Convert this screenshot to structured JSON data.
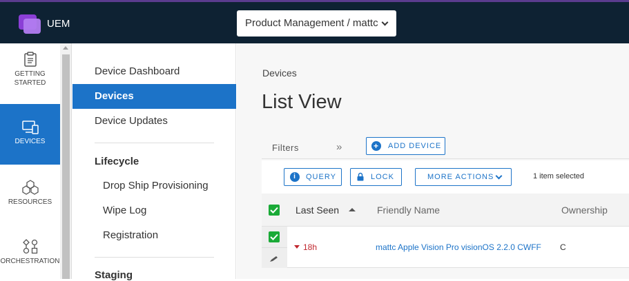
{
  "header": {
    "app_name": "UEM",
    "org_selector": "Product Management / mattc"
  },
  "leftnav": {
    "items": [
      {
        "label_line1": "GETTING",
        "label_line2": "STARTED",
        "icon": "clipboard-icon"
      },
      {
        "label_line1": "DEVICES",
        "label_line2": "",
        "icon": "devices-icon"
      },
      {
        "label_line1": "RESOURCES",
        "label_line2": "",
        "icon": "cubes-icon"
      },
      {
        "label_line1": "ORCHESTRATION",
        "label_line2": "",
        "icon": "workflow-icon"
      }
    ]
  },
  "subnav": {
    "items": [
      "Device Dashboard",
      "Devices",
      "Device Updates"
    ],
    "lifecycle_heading": "Lifecycle",
    "lifecycle_items": [
      "Drop Ship Provisioning",
      "Wipe Log",
      "Registration"
    ],
    "staging_heading": "Staging"
  },
  "main": {
    "breadcrumb": "Devices",
    "title": "List View",
    "filters_label": "Filters",
    "expand_icon": "»",
    "add_device_label": "ADD DEVICE",
    "query_label": "QUERY",
    "lock_label": "LOCK",
    "more_actions_label": "MORE ACTIONS",
    "selected_text": "1 item selected",
    "columns": [
      "Last Seen",
      "Friendly Name",
      "Ownership"
    ],
    "rows": [
      {
        "last_seen": "18h",
        "friendly_name": "mattc Apple Vision Pro visionOS 2.2.0 CWFF",
        "ownership": "C"
      }
    ]
  },
  "colors": {
    "topbar": "#0e2233",
    "accent": "#1c73c8",
    "checkbox": "#1aaa37",
    "alert": "#c0262d"
  }
}
